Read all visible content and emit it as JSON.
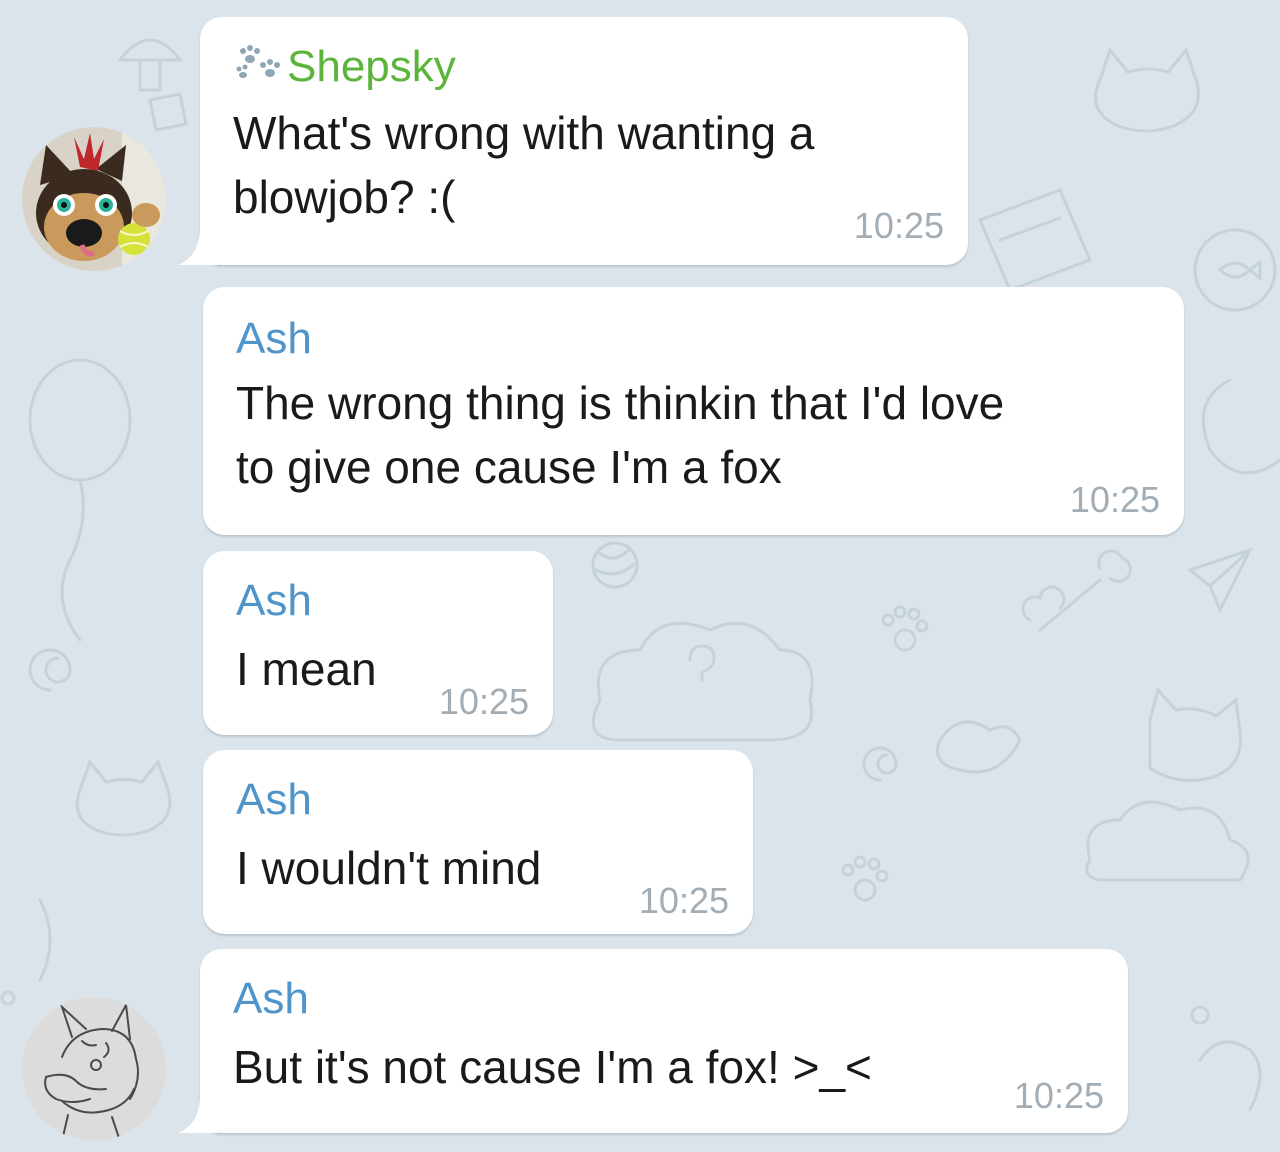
{
  "colors": {
    "background": "#dbe4ea",
    "bubble": "#ffffff",
    "sender_green": "#5cb53a",
    "sender_blue": "#4f95c9",
    "timestamp": "#a2adb5",
    "text": "#1a1a1a"
  },
  "messages": [
    {
      "sender": "Shepsky",
      "sender_icon": "paw-prints-icon",
      "text": "What's wrong with wanting a\nblowjob? :(",
      "time": "10:25",
      "avatar": "shepsky-fursuit-avatar"
    },
    {
      "sender": "Ash",
      "text": "The wrong thing is thinkin that I'd love\nto give one cause I'm a fox",
      "time": "10:25"
    },
    {
      "sender": "Ash",
      "text": "I mean",
      "time": "10:25"
    },
    {
      "sender": "Ash",
      "text": "I wouldn't mind",
      "time": "10:25"
    },
    {
      "sender": "Ash",
      "text": "But it's not cause I'm a fox! >_<",
      "time": "10:25",
      "avatar": "ash-sketch-avatar"
    }
  ]
}
